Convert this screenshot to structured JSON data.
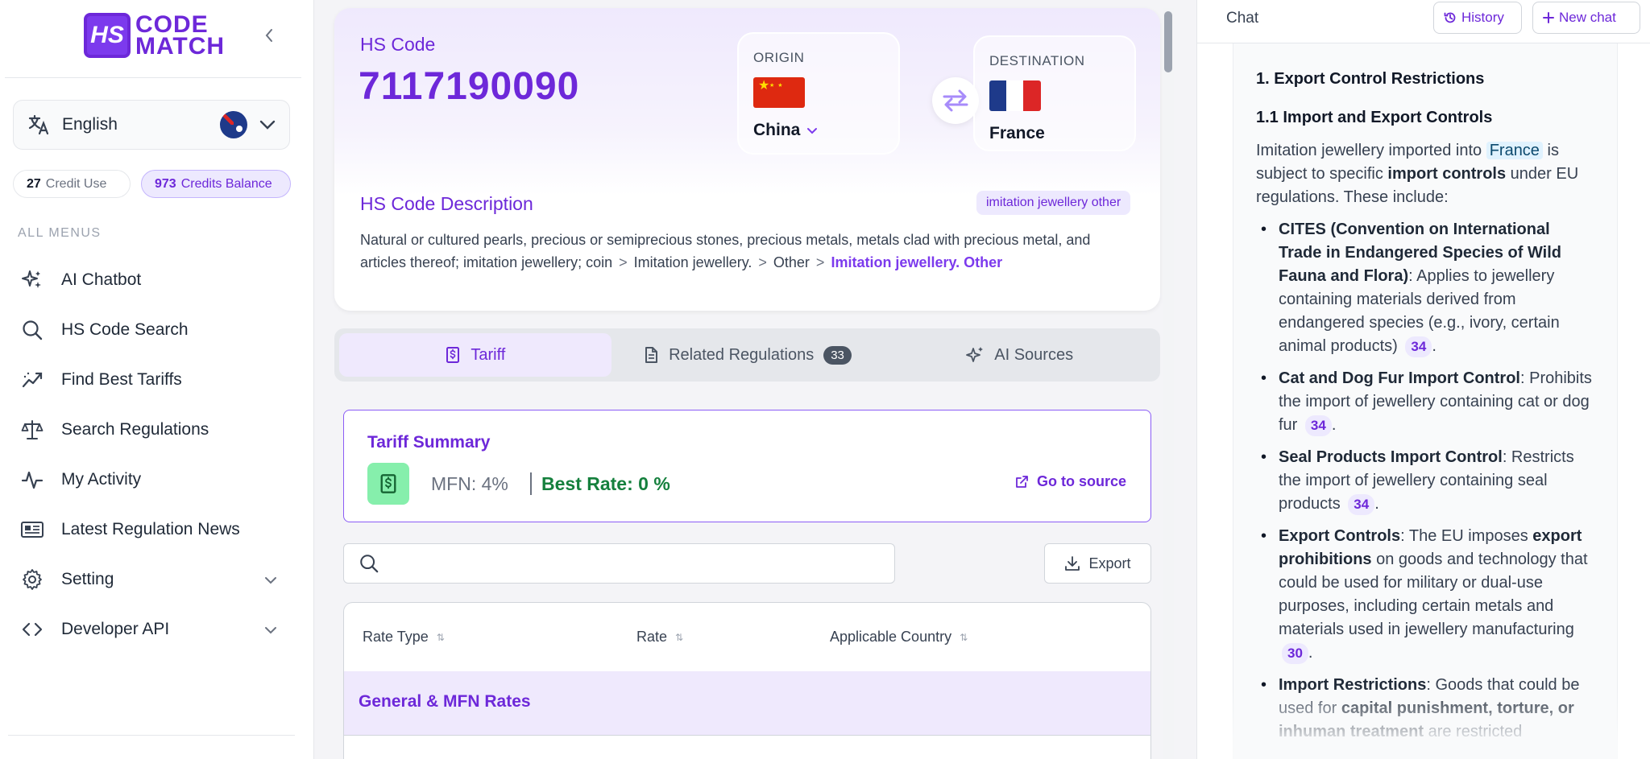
{
  "sidebar": {
    "logo_mark": "HS",
    "logo_text_line1": "CODE",
    "logo_text_line2": "MATCH",
    "language": "English",
    "credit_use_value": "27",
    "credit_use_label": "Credit Use",
    "credit_balance_value": "973",
    "credit_balance_label": "Credits Balance",
    "menus_title": "ALL MENUS",
    "items": [
      {
        "label": "AI Chatbot",
        "icon": "sparkles-icon"
      },
      {
        "label": "HS Code Search",
        "icon": "search-icon"
      },
      {
        "label": "Find Best Tariffs",
        "icon": "trend-chart-icon"
      },
      {
        "label": "Search Regulations",
        "icon": "scale-icon"
      },
      {
        "label": "My Activity",
        "icon": "activity-icon"
      },
      {
        "label": "Latest Regulation News",
        "icon": "newspaper-icon"
      },
      {
        "label": "Setting",
        "icon": "gear-icon"
      },
      {
        "label": "Developer API",
        "icon": "code-icon"
      }
    ]
  },
  "hs": {
    "label": "HS Code",
    "code": "7117190090",
    "origin_caption": "ORIGIN",
    "origin_name": "China",
    "destination_caption": "DESTINATION",
    "destination_name": "France",
    "desc_title": "HS Code Description",
    "desc_tag": "imitation jewellery other",
    "desc_part1": "Natural or cultured pearls, precious or semiprecious stones, precious metals, metals clad with precious metal, and articles thereof; imitation jewellery; coin",
    "desc_sep": ">",
    "desc_part2": "Imitation jewellery.",
    "desc_part3": "Other",
    "desc_highlight": "Imitation jewellery. Other"
  },
  "tabs": [
    {
      "label": "Tariff"
    },
    {
      "label": "Related Regulations",
      "badge": "33"
    },
    {
      "label": "AI Sources"
    }
  ],
  "tariff_summary": {
    "title": "Tariff Summary",
    "mfn": "MFN: 4%",
    "best_rate": "Best Rate: 0 %",
    "source_link": "Go to source"
  },
  "search": {
    "placeholder": ""
  },
  "export_label": "Export",
  "table": {
    "columns": [
      "Rate Type",
      "Rate",
      "Applicable Country"
    ],
    "group_label": "General & MFN Rates"
  },
  "chat": {
    "title": "Chat",
    "history_label": "History",
    "new_chat_label": "New chat",
    "h1": "1. Export Control Restrictions",
    "h2": "1.1 Import and Export Controls",
    "intro_a": "Imitation jewellery imported into",
    "intro_country": "France",
    "intro_b": "is subject to specific",
    "intro_bold": "import controls",
    "intro_c": "under EU regulations. These include:",
    "bullets": [
      {
        "bold": "CITES (Convention on International Trade in Endangered Species of Wild Fauna and Flora)",
        "text": ": Applies to jewellery containing materials derived from endangered species (e.g., ivory, certain animal products)",
        "cite": "34"
      },
      {
        "bold": "Cat and Dog Fur Import Control",
        "text": ": Prohibits the import of jewellery containing cat or dog fur",
        "cite": "34"
      },
      {
        "bold": "Seal Products Import Control",
        "text": ": Restricts the import of jewellery containing seal products",
        "cite": "34"
      },
      {
        "bold": "Export Controls",
        "text_a": ": The EU imposes",
        "bold2": "export prohibitions",
        "text_b": "on goods and technology that could be used for military or dual-use purposes, including certain metals and materials used in jewellery manufacturing",
        "cite": "30"
      },
      {
        "bold": "Import Restrictions",
        "text_a": ": Goods that could be used for",
        "bold2": "capital punishment, torture, or inhuman treatment",
        "text_b": "are restricted"
      }
    ]
  }
}
